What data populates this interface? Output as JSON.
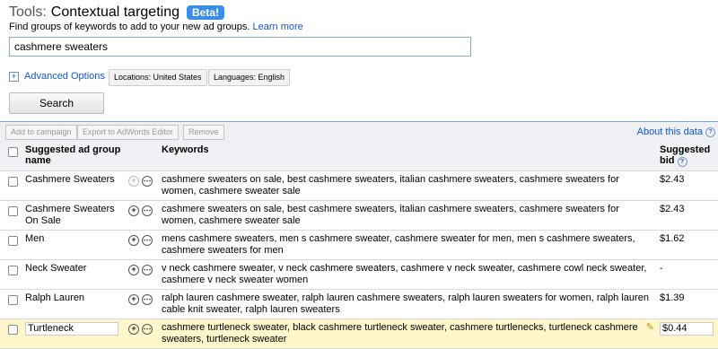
{
  "header": {
    "tools_label": "Tools:",
    "title": "Contextual targeting",
    "badge": "Beta!",
    "subtitle": "Find groups of keywords to add to your new ad groups.",
    "learn_more": "Learn more"
  },
  "search": {
    "value": "cashmere sweaters",
    "button": "Search"
  },
  "options": {
    "advanced": "Advanced Options",
    "location": "Locations: United States",
    "language": "Languages: English"
  },
  "toolbar": {
    "add": "Add to campaign",
    "export": "Export to AdWords Editor",
    "remove": "Remove",
    "about": "About this data"
  },
  "table": {
    "columns": {
      "group": "Suggested ad group name",
      "keywords": "Keywords",
      "bid": "Suggested bid"
    },
    "rows": [
      {
        "group": "Cashmere Sweaters",
        "keywords": "cashmere sweaters on sale, best cashmere sweaters, italian cashmere sweaters, cashmere sweaters for women, cashmere sweater sale",
        "bid": "$2.43"
      },
      {
        "group": "Cashmere Sweaters On Sale",
        "keywords": "cashmere sweaters on sale, best cashmere sweaters, italian cashmere sweaters, cashmere sweaters for women, cashmere sweater sale",
        "bid": "$2.43"
      },
      {
        "group": "Men",
        "keywords": "mens cashmere sweaters, men s cashmere sweater, cashmere sweater for men, men s cashmere sweaters, cashmere sweaters for men",
        "bid": "$1.62"
      },
      {
        "group": "Neck Sweater",
        "keywords": "v neck cashmere sweater, v neck cashmere sweaters, cashmere v neck sweater, cashmere cowl neck sweater, cashmere v neck sweater women",
        "bid": "-"
      },
      {
        "group": "Ralph Lauren",
        "keywords": "ralph lauren cashmere sweater, ralph lauren cashmere sweaters, ralph lauren sweaters for women, ralph lauren cable knit sweater, ralph lauren sweaters",
        "bid": "$1.39"
      },
      {
        "group": "Turtleneck",
        "keywords": "cashmere turtleneck sweater, black cashmere turtleneck sweater, cashmere turtlenecks, turtleneck cashmere sweaters, turtleneck sweater",
        "bid": "$0.44"
      }
    ]
  }
}
